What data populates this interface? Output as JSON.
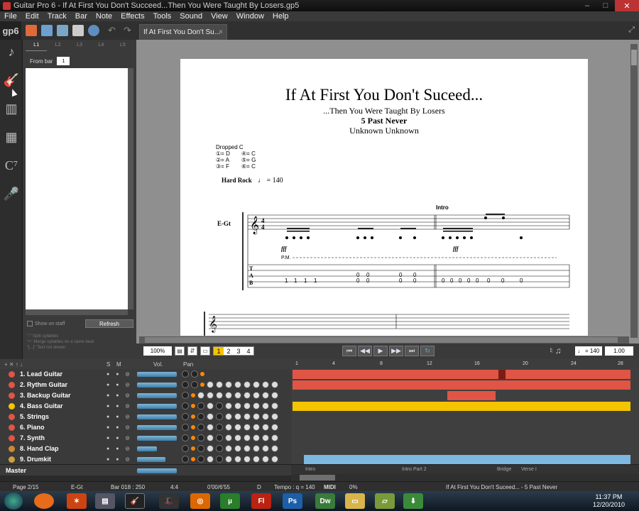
{
  "window": {
    "title": "Guitar Pro 6 - If At First You Don't Succeed...Then You Were Taught By Losers.gp5"
  },
  "menu": [
    "File",
    "Edit",
    "Track",
    "Bar",
    "Note",
    "Effects",
    "Tools",
    "Sound",
    "View",
    "Window",
    "Help"
  ],
  "toolbar": {
    "logo": "gp6"
  },
  "document_tab": {
    "label": "If At First You Don't Su...",
    "close": "×"
  },
  "lyrics_panel": {
    "tabs": [
      "L1",
      "L2",
      "L3",
      "L4",
      "L5"
    ],
    "from_bar_label": "From bar",
    "from_bar_value": "1",
    "show_on_staff": "Show on staff",
    "refresh": "Refresh",
    "options": [
      "\"-\" Split syllables",
      "\"+\" Merge syllables on a same beat",
      "\"[...]\" Text not shown"
    ]
  },
  "score": {
    "title": "If At First You Don't Suceed...",
    "subtitle": "...Then You Were Taught By Losers",
    "artist": "5 Past Never",
    "author": "Unknown Unknown",
    "tuning_label": "Dropped C",
    "tuning": [
      "①= D",
      "④= C",
      "②= A",
      "⑤= G",
      "③= F",
      "⑥= C"
    ],
    "tempo_label": "Hard Rock",
    "tempo_value": "♩ = 140",
    "section": "Intro",
    "instrument": "E-Gt",
    "dynamics": [
      "fff",
      "fff"
    ],
    "palm_mute": "P.M."
  },
  "transport": {
    "zoom": "100%",
    "voices": [
      "1",
      "2",
      "3",
      "4"
    ],
    "tempo": "♩ = 140",
    "speed": "1.00"
  },
  "tracks": {
    "header": {
      "vol": "Vol.",
      "pan": "Pan",
      "s": "S",
      "m": "M"
    },
    "bar_numbers": [
      "1",
      "4",
      "8",
      "12",
      "16",
      "20",
      "24",
      "28"
    ],
    "rows": [
      {
        "name": "1. Lead Guitar",
        "color": "#e05545"
      },
      {
        "name": "2. Rythm Guitar",
        "color": "#e05545"
      },
      {
        "name": "3. Backup Guitar",
        "color": "#e05545"
      },
      {
        "name": "4. Bass Guitar",
        "color": "#f5c400"
      },
      {
        "name": "5. Strings",
        "color": "#e05545"
      },
      {
        "name": "6. Piano",
        "color": "#e05545"
      },
      {
        "name": "7. Synth",
        "color": "#e05545"
      },
      {
        "name": "8. Hand Clap",
        "color": "#d08830"
      },
      {
        "name": "9. Drumkit",
        "color": "#d0a040"
      }
    ],
    "master": "Master",
    "sections": [
      "Intro",
      "Intro Part 2",
      "Bridge",
      "Verse I"
    ]
  },
  "status": {
    "page": "Page 2/15",
    "instrument": "E-Gt",
    "bar": "Bar 018 : 250",
    "signature": "4:4",
    "time": "0'00/6'55",
    "key": "D",
    "tempo": "Tempo : q = 140",
    "midi": "MIDI",
    "percent": "0%",
    "song": "If At First You Don't Suceed... - 5 Past Never"
  },
  "taskbar": {
    "time": "11:37 PM",
    "date": "12/20/2010"
  }
}
